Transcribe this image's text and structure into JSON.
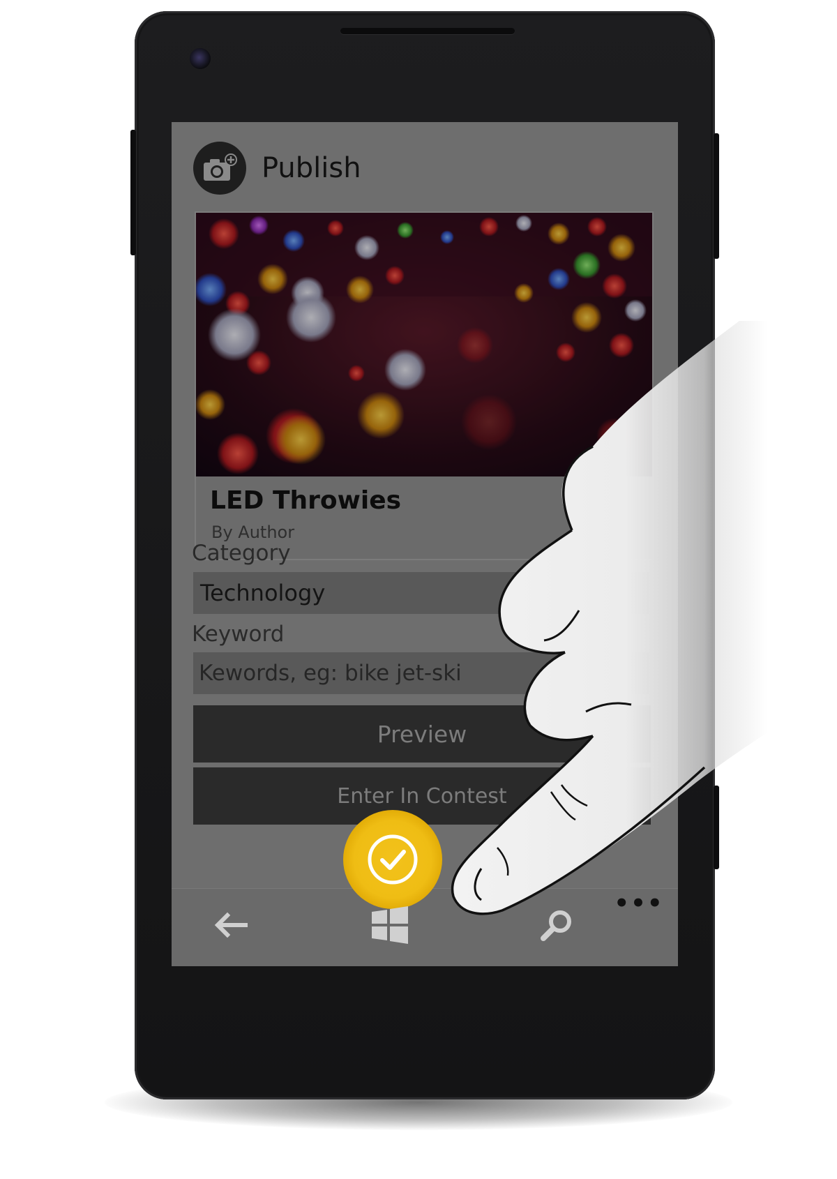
{
  "app": {
    "title": "Publish",
    "logo_icon": "camera-add-icon"
  },
  "project": {
    "title": "LED Throwies",
    "author": "By Author"
  },
  "form": {
    "category_label": "Category",
    "category_value": "Technology",
    "keyword_label": "Keyword",
    "keyword_placeholder": "Kewords, eg: bike jet-ski"
  },
  "buttons": {
    "preview": "Preview",
    "enter_contest": "Enter In Contest"
  },
  "appbar": {
    "accept_icon": "check-circle-icon",
    "more_label": "•••",
    "accent_color": "#f0bf16"
  },
  "hardware_keys": [
    "back-arrow-icon",
    "windows-logo-icon",
    "search-icon"
  ]
}
